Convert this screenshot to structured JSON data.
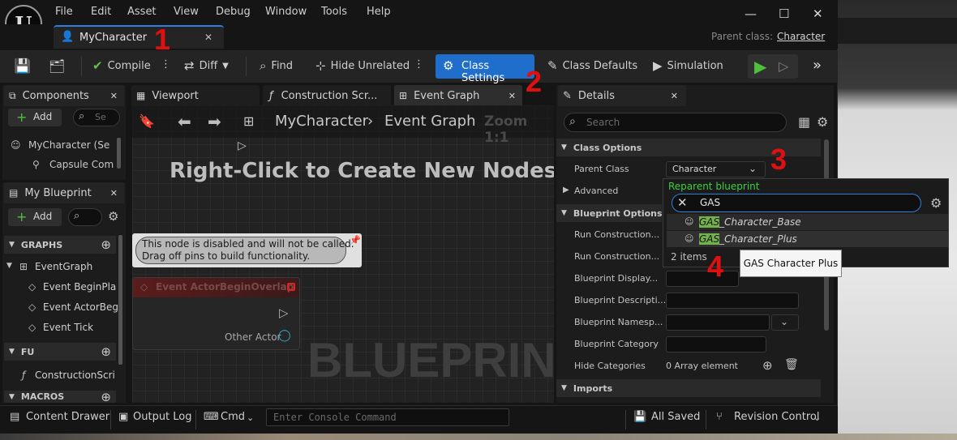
{
  "menu": [
    "File",
    "Edit",
    "Asset",
    "View",
    "Debug",
    "Window",
    "Tools",
    "Help"
  ],
  "tab": {
    "title": "MyCharacter",
    "parent_label": "Parent class:",
    "parent_value": "Character"
  },
  "toolbar": {
    "compile": "Compile",
    "diff": "Diff",
    "find": "Find",
    "hide_unrelated": "Hide Unrelated",
    "class_settings": "Class Settings",
    "class_defaults": "Class Defaults",
    "simulation": "Simulation"
  },
  "components": {
    "title": "Components",
    "add": "Add",
    "search_placeholder": "Se",
    "items": [
      "MyCharacter (Se",
      "Capsule Com"
    ]
  },
  "myblueprint": {
    "title": "My Blueprint",
    "add": "Add",
    "graphs_header": "GRAPHS",
    "event_graph": "EventGraph",
    "events": [
      "Event BeginPla",
      "Event ActorBeg",
      "Event Tick"
    ],
    "functions_header": "FU",
    "construction": "ConstructionScri",
    "macros_header": "MACROS"
  },
  "center_tabs": [
    "Viewport",
    "Construction Scr...",
    "Event Graph"
  ],
  "graph": {
    "breadcrumb_root": "MyCharacter",
    "breadcrumb_sep": "›",
    "breadcrumb_leaf": "Event Graph",
    "zoom": "Zoom 1:1",
    "hint": "Right-Click to Create New Nodes.",
    "comment_line1": "This node is disabled and will not be called.",
    "comment_line2": "Drag off pins to build functionality.",
    "node_title": "Event ActorBeginOverlap",
    "pin_label": "Other Actor",
    "watermark": "BLUEPRINT"
  },
  "details": {
    "title": "Details",
    "search_placeholder": "Search",
    "class_options": "Class Options",
    "parent_class_label": "Parent Class",
    "parent_class_value": "Character",
    "advanced": "Advanced",
    "blueprint_options": "Blueprint Options",
    "rows": [
      "Run Construction...",
      "Run Construction...",
      "Blueprint Display...",
      "Blueprint Descripti...",
      "Blueprint Namesp...",
      "Blueprint Category",
      "Hide Categories"
    ],
    "hide_categories_value": "0 Array element",
    "imports": "Imports"
  },
  "reparent": {
    "header": "Reparent blueprint",
    "search_value": "GAS",
    "items": [
      {
        "match": "GAS",
        "rest": "_Character_Base"
      },
      {
        "match": "GAS",
        "rest": "_Character_Plus"
      }
    ],
    "count": "2 items",
    "tooltip": "GAS Character Plus"
  },
  "annotations": [
    "1",
    "2",
    "3",
    "4"
  ],
  "statusbar": {
    "content_drawer": "Content Drawer",
    "output_log": "Output Log",
    "cmd": "Cmd",
    "console_placeholder": "Enter Console Command",
    "saved": "All Saved",
    "revision": "Revision Control"
  },
  "colors": {
    "accent": "#1f6ecb",
    "annotation": "#e01010",
    "highlight": "#74b34b",
    "reparent_header": "#3cd13c"
  }
}
